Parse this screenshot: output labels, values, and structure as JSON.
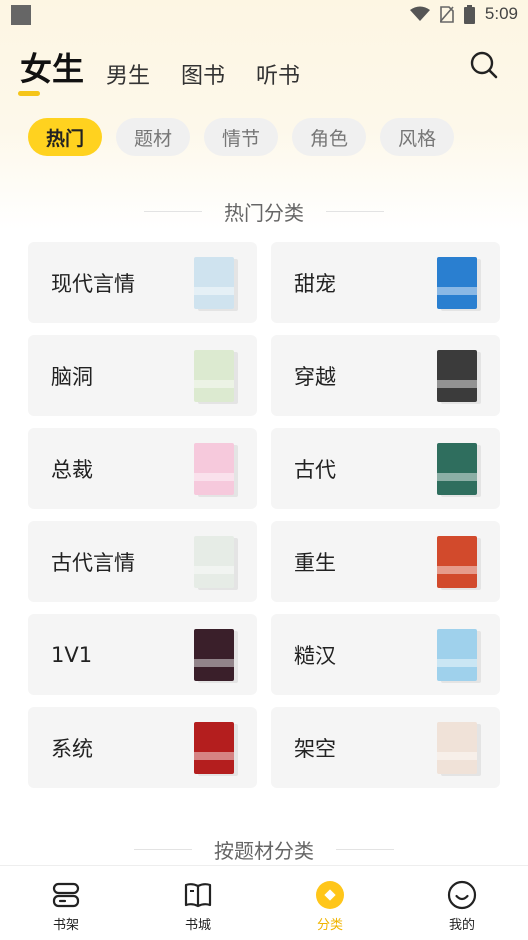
{
  "status_bar": {
    "time": "5:09"
  },
  "header": {
    "tabs": [
      {
        "label": "女生",
        "active": true
      },
      {
        "label": "男生",
        "active": false
      },
      {
        "label": "图书",
        "active": false
      },
      {
        "label": "听书",
        "active": false
      }
    ]
  },
  "chips": [
    {
      "label": "热门",
      "active": true
    },
    {
      "label": "题材",
      "active": false
    },
    {
      "label": "情节",
      "active": false
    },
    {
      "label": "角色",
      "active": false
    },
    {
      "label": "风格",
      "active": false
    }
  ],
  "sections": {
    "hot": {
      "title": "热门分类"
    },
    "by_theme": {
      "title": "按题材分类"
    }
  },
  "categories": [
    {
      "label": "现代言情",
      "cover_color": "#cfe3ef"
    },
    {
      "label": "甜宠",
      "cover_color": "#2a7fd0"
    },
    {
      "label": "脑洞",
      "cover_color": "#dcead0"
    },
    {
      "label": "穿越",
      "cover_color": "#3b3b3b"
    },
    {
      "label": "总裁",
      "cover_color": "#f6c9dc"
    },
    {
      "label": "古代",
      "cover_color": "#2f6e5e"
    },
    {
      "label": "古代言情",
      "cover_color": "#e6ece6"
    },
    {
      "label": "重生",
      "cover_color": "#d24a2c"
    },
    {
      "label": "1V1",
      "cover_color": "#3a1f2a"
    },
    {
      "label": "糙汉",
      "cover_color": "#9fd1ec"
    },
    {
      "label": "系统",
      "cover_color": "#b41e1e"
    },
    {
      "label": "架空",
      "cover_color": "#f0e2d8"
    }
  ],
  "bottom_nav": [
    {
      "label": "书架",
      "icon": "bookshelf-icon",
      "active": false
    },
    {
      "label": "书城",
      "icon": "book-icon",
      "active": false
    },
    {
      "label": "分类",
      "icon": "category-icon",
      "active": true
    },
    {
      "label": "我的",
      "icon": "profile-icon",
      "active": false
    }
  ],
  "colors": {
    "accent": "#ffd21f",
    "nav_active": "#f0b400"
  }
}
